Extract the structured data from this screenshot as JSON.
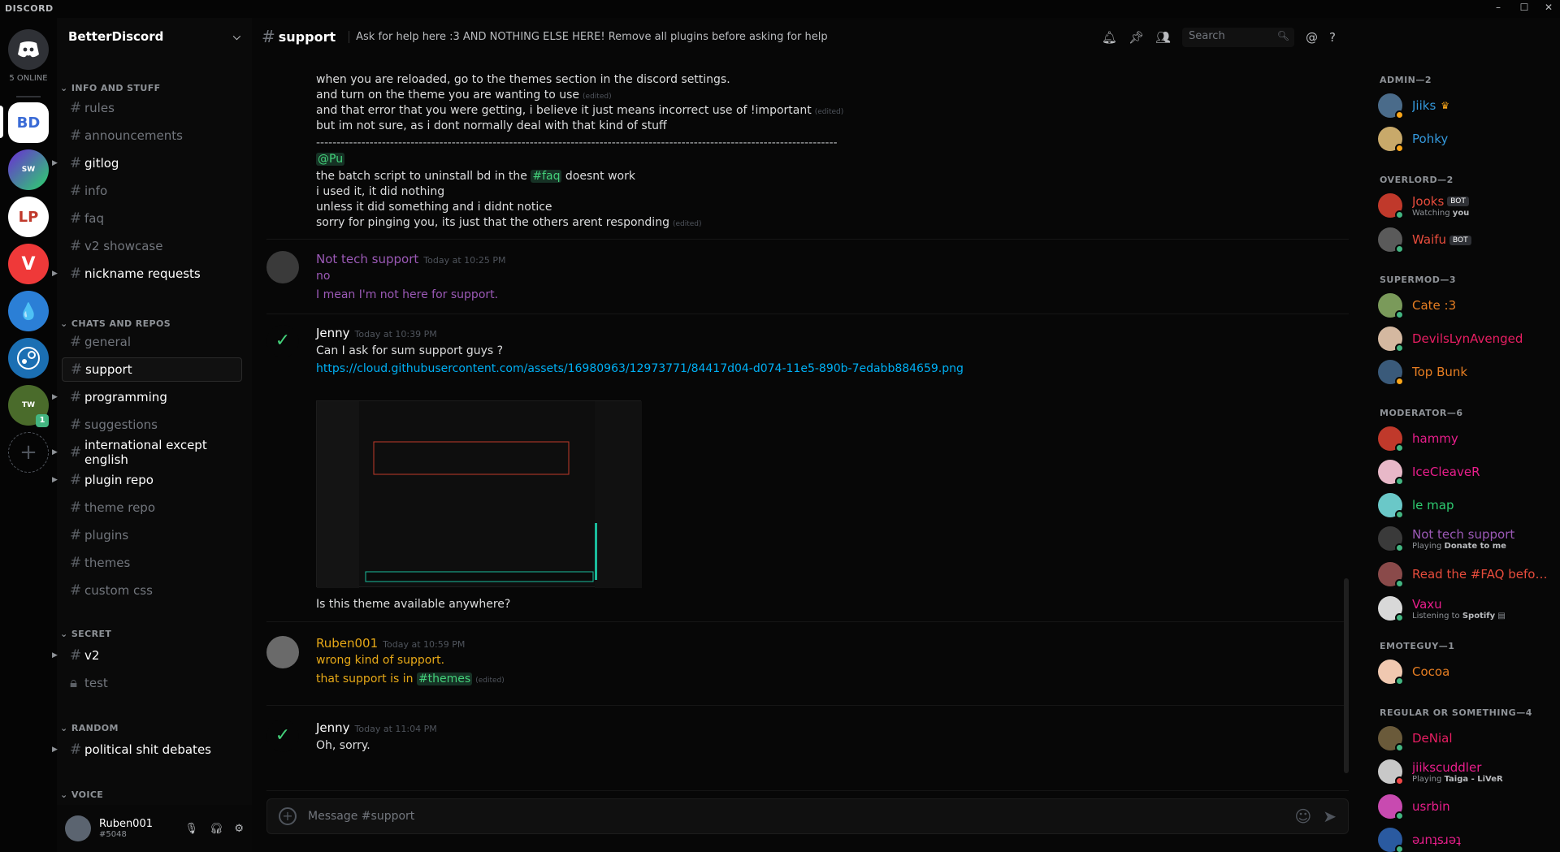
{
  "window": {
    "brand": "DISCORD",
    "minimize": "–",
    "maximize": "☐",
    "close": "✕"
  },
  "servers": {
    "online_count": "5 ONLINE",
    "badge": "1",
    "add_symbol": "+"
  },
  "guild": {
    "name": "BetterDiscord"
  },
  "categories": {
    "info": "INFO AND STUFF",
    "chats": "CHATS AND REPOS",
    "secret": "SECRET",
    "random": "RANDOM",
    "voice": "VOICE"
  },
  "channels": [
    "rules",
    "announcements",
    "gitlog",
    "info",
    "faq",
    "v2 showcase",
    "nickname requests",
    "general",
    "support",
    "programming",
    "suggestions",
    "international except english",
    "plugin repo",
    "theme repo",
    "plugins",
    "themes",
    "custom css",
    "v2",
    "test",
    "political shit debates"
  ],
  "user": {
    "name": "Ruben001",
    "tag": "#5048"
  },
  "chat": {
    "channel": "support",
    "topic": "Ask for help here :3 AND NOTHING ELSE HERE! Remove all plugins before asking for help",
    "search_placeholder": "Search",
    "composer_placeholder": "Message #support",
    "edited": "(edited)",
    "lines_top": [
      "when you are reloaded, go to the themes section in the discord settings.",
      "and turn on the theme you are wanting to use",
      "and that error that you were getting, i believe it just means incorrect use of !important",
      "but im not sure, as i dont normally deal with that kind of stuff",
      "-------------------------------------------------------------------------------------------------------------------------------",
      "@Pu",
      "the batch script to uninstall bd in the",
      "#faq",
      "doesnt work",
      "i used it, it did nothing",
      "unless it did something and i didnt notice",
      "sorry for pinging you, its just that the others arent responding"
    ],
    "messages": [
      {
        "author": "Not tech support",
        "time": "Today at 10:25 PM",
        "lines": [
          "no",
          "I mean I'm not here for support."
        ]
      },
      {
        "author": "Jenny",
        "time": "Today at 10:39 PM",
        "lines": [
          "Can I ask for sum support guys ?",
          "https://cloud.githubusercontent.com/assets/16980963/12973771/84417d04-d074-11e5-890b-7edabb884659.png",
          "Is this theme available anywhere?"
        ]
      },
      {
        "author": "Ruben001",
        "time": "Today at 10:59 PM",
        "lines": [
          "wrong kind of support.",
          "that support is in",
          "#themes"
        ]
      },
      {
        "author": "Jenny",
        "time": "Today at 11:04 PM",
        "lines": [
          "Oh, sorry."
        ]
      }
    ]
  },
  "members": {
    "roles": [
      "ADMIN—2",
      "OVERLORD—2",
      "SUPERMOD—3",
      "MODERATOR—6",
      "EMOTEGUY—1",
      "REGULAR OR SOMETHING—4"
    ],
    "list": [
      {
        "name": "Jiiks",
        "color": "#3498db",
        "status": "#faa61a"
      },
      {
        "name": "Pohky",
        "color": "#3498db",
        "status": "#faa61a"
      },
      {
        "name": "Jooks",
        "color": "#e74c3c",
        "status": "#43b581",
        "activity": "Watching",
        "activity_bold": "you",
        "bot": "BOT"
      },
      {
        "name": "Waifu",
        "color": "#e74c3c",
        "status": "#43b581",
        "bot": "BOT"
      },
      {
        "name": "Cate :3",
        "color": "#e67e22",
        "status": "#43b581"
      },
      {
        "name": "DevilsLynAvenged",
        "color": "#e91e63",
        "status": "#43b581"
      },
      {
        "name": "Top Bunk",
        "color": "#e67e22",
        "status": "#faa61a"
      },
      {
        "name": "hammy",
        "color": "#e91e8c",
        "status": "#43b581"
      },
      {
        "name": "IceCleaveR",
        "color": "#e91e8c",
        "status": "#43b581"
      },
      {
        "name": "le map",
        "color": "#2ecc71",
        "status": "#43b581"
      },
      {
        "name": "Not tech support",
        "color": "#9b59b6",
        "status": "#43b581",
        "activity": "Playing",
        "activity_bold": "Donate to me"
      },
      {
        "name": "Read the #FAQ before ...",
        "color": "#e74c3c",
        "status": "#43b581"
      },
      {
        "name": "Vaxu",
        "color": "#e91e8c",
        "status": "#43b581",
        "activity": "Listening to",
        "activity_bold": "Spotify"
      },
      {
        "name": "Cocoa",
        "color": "#e67e22",
        "status": "#43b581"
      },
      {
        "name": "DeNial",
        "color": "#e91e63",
        "status": "#43b581"
      },
      {
        "name": "jiikscuddler",
        "color": "#e91e8c",
        "status": "#f04747",
        "activity": "Playing",
        "activity_bold": "Taiga - LiVeR"
      },
      {
        "name": "usrbin",
        "color": "#e91e8c",
        "status": "#43b581"
      },
      {
        "name": "ǝɹnʇsɹǝʇ",
        "color": "#e91e8c",
        "status": "#43b581"
      }
    ]
  },
  "colors": {
    "accent": "#7289da",
    "link": "#00b0f4",
    "mention": "#43d17a",
    "online": "#43b581",
    "idle": "#faa61a",
    "dnd": "#f04747"
  },
  "icons": [
    "discord-logo",
    "bell-icon",
    "pin-icon",
    "members-icon",
    "search-icon",
    "at-icon",
    "help-icon",
    "mic-icon",
    "headphones-icon",
    "gear-icon",
    "plus-icon",
    "emoji-icon",
    "send-icon",
    "chevron-down-icon",
    "lock-icon"
  ]
}
